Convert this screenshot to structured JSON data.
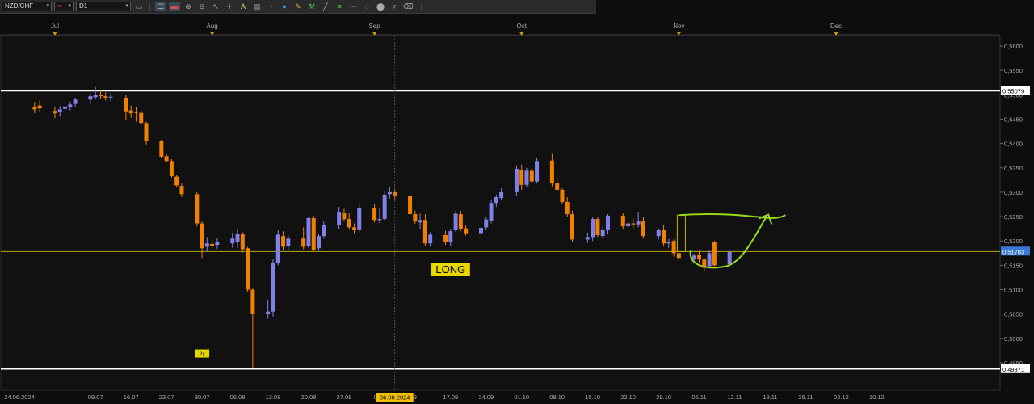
{
  "toolbar": {
    "symbol": "NZD/CHF",
    "link_icon": "link-icon",
    "timeframe": "D1",
    "buttons": [
      "chart-type-icon",
      "bars-icon",
      "candles-icon",
      "zoom-in-icon",
      "zoom-out-icon",
      "cursor-icon",
      "crosshair-icon",
      "text-icon",
      "comment-icon",
      "fill-icon",
      "circle-icon",
      "pencil-icon",
      "tools-icon",
      "line-icon",
      "channel-icon",
      "fib-icon",
      "ellipse-icon",
      "shape-icon",
      "eraser-icon",
      "more-icon"
    ]
  },
  "colors": {
    "bull": "#8080e8",
    "bear": "#f08000",
    "hline_white": "#ffffff",
    "hline_yellow": "#b5a800",
    "current_price_bg": "#3a78d8",
    "annotation": "#9ad91a",
    "long_label_bg": "#e8d800",
    "date_highlight_bg": "#f0c000",
    "rect_outline": "#c8b000"
  },
  "chart_data": {
    "type": "candlestick",
    "symbol": "NZD/CHF",
    "timeframe": "D1",
    "month_labels": [
      "Jul",
      "Aug",
      "Sep",
      "Oct",
      "Nov",
      "Dec"
    ],
    "month_dates": [
      "2024-07-01",
      "2024-08-01",
      "2024-09-02",
      "2024-10-01",
      "2024-11-01",
      "2024-12-02"
    ],
    "x_ticks": [
      "24.06.2024",
      "09.07",
      "16.07",
      "23.07",
      "30.07",
      "06.08",
      "13.08",
      "20.08",
      "27.08",
      "03.0",
      "06.09.2024",
      "9",
      "17.09",
      "24.09",
      "01.10",
      "08.10",
      "15.10",
      "22.10",
      "29.10",
      "05.11",
      "12.11",
      "19.11",
      "26.11",
      "03.12",
      "10.12"
    ],
    "x_tick_dates": [
      "2024-06-24",
      "2024-07-09",
      "2024-07-16",
      "2024-07-23",
      "2024-07-30",
      "2024-08-06",
      "2024-08-13",
      "2024-08-20",
      "2024-08-27",
      "2024-09-03",
      "2024-09-06",
      "2024-09-10",
      "2024-09-17",
      "2024-09-24",
      "2024-10-01",
      "2024-10-08",
      "2024-10-15",
      "2024-10-22",
      "2024-10-29",
      "2024-11-05",
      "2024-11-12",
      "2024-11-19",
      "2024-11-26",
      "2024-12-03",
      "2024-12-10"
    ],
    "highlighted_date": "06.09.2024",
    "y_ticks": [
      "0,5600",
      "0,5550",
      "0,5500",
      "0,5450",
      "0,5400",
      "0,5350",
      "0,5300",
      "0,5250",
      "0,5200",
      "0,5150",
      "0,5100",
      "0,5050",
      "0,5000",
      "0,4950"
    ],
    "y_tick_values": [
      0.56,
      0.555,
      0.55,
      0.545,
      0.54,
      0.535,
      0.53,
      0.525,
      0.52,
      0.515,
      0.51,
      0.505,
      0.5,
      0.495
    ],
    "ylim": [
      0.4925,
      0.5623
    ],
    "levels": [
      {
        "label": "0,55079",
        "value": 0.55079,
        "style": "white"
      },
      {
        "label": "0,51783",
        "value": 0.51783,
        "style": "current"
      },
      {
        "label": "0,49371",
        "value": 0.49371,
        "style": "white"
      }
    ],
    "candles": [
      {
        "d": "2024-06-27",
        "o": 0.5475,
        "h": 0.5485,
        "l": 0.5462,
        "c": 0.547
      },
      {
        "d": "2024-06-28",
        "o": 0.5478,
        "h": 0.5488,
        "l": 0.5465,
        "c": 0.5472
      },
      {
        "d": "2024-07-01",
        "o": 0.5467,
        "h": 0.5476,
        "l": 0.5452,
        "c": 0.5462
      },
      {
        "d": "2024-07-02",
        "o": 0.5464,
        "h": 0.5477,
        "l": 0.5455,
        "c": 0.547
      },
      {
        "d": "2024-07-03",
        "o": 0.5471,
        "h": 0.5483,
        "l": 0.5462,
        "c": 0.5476
      },
      {
        "d": "2024-07-04",
        "o": 0.5475,
        "h": 0.5486,
        "l": 0.5468,
        "c": 0.548
      },
      {
        "d": "2024-07-05",
        "o": 0.5481,
        "h": 0.5494,
        "l": 0.5474,
        "c": 0.549
      },
      {
        "d": "2024-07-08",
        "o": 0.549,
        "h": 0.5502,
        "l": 0.5481,
        "c": 0.5497
      },
      {
        "d": "2024-07-09",
        "o": 0.5495,
        "h": 0.5516,
        "l": 0.549,
        "c": 0.55
      },
      {
        "d": "2024-07-10",
        "o": 0.55,
        "h": 0.551,
        "l": 0.5491,
        "c": 0.5497
      },
      {
        "d": "2024-07-11",
        "o": 0.5497,
        "h": 0.5505,
        "l": 0.5488,
        "c": 0.5494
      },
      {
        "d": "2024-07-12",
        "o": 0.5494,
        "h": 0.5503,
        "l": 0.5486,
        "c": 0.5496
      },
      {
        "d": "2024-07-15",
        "o": 0.5494,
        "h": 0.55,
        "l": 0.5448,
        "c": 0.5466
      },
      {
        "d": "2024-07-16",
        "o": 0.5468,
        "h": 0.5478,
        "l": 0.5453,
        "c": 0.5462
      },
      {
        "d": "2024-07-17",
        "o": 0.5465,
        "h": 0.5474,
        "l": 0.5445,
        "c": 0.5463
      },
      {
        "d": "2024-07-18",
        "o": 0.5463,
        "h": 0.5468,
        "l": 0.5438,
        "c": 0.5442
      },
      {
        "d": "2024-07-19",
        "o": 0.5442,
        "h": 0.5445,
        "l": 0.5398,
        "c": 0.5405
      },
      {
        "d": "2024-07-22",
        "o": 0.5405,
        "h": 0.5408,
        "l": 0.537,
        "c": 0.5373
      },
      {
        "d": "2024-07-23",
        "o": 0.5374,
        "h": 0.5378,
        "l": 0.5362,
        "c": 0.5364
      },
      {
        "d": "2024-07-24",
        "o": 0.5364,
        "h": 0.5368,
        "l": 0.533,
        "c": 0.5333
      },
      {
        "d": "2024-07-25",
        "o": 0.5332,
        "h": 0.5335,
        "l": 0.531,
        "c": 0.5314
      },
      {
        "d": "2024-07-26",
        "o": 0.5313,
        "h": 0.5318,
        "l": 0.529,
        "c": 0.5296
      },
      {
        "d": "2024-07-29",
        "o": 0.5296,
        "h": 0.53,
        "l": 0.523,
        "c": 0.5236
      },
      {
        "d": "2024-07-30",
        "o": 0.5236,
        "h": 0.524,
        "l": 0.5165,
        "c": 0.5185
      },
      {
        "d": "2024-07-31",
        "o": 0.5188,
        "h": 0.5208,
        "l": 0.5178,
        "c": 0.5195
      },
      {
        "d": "2024-08-01",
        "o": 0.5194,
        "h": 0.5207,
        "l": 0.518,
        "c": 0.519
      },
      {
        "d": "2024-08-02",
        "o": 0.5192,
        "h": 0.5206,
        "l": 0.5184,
        "c": 0.5198
      },
      {
        "d": "2024-08-05",
        "o": 0.5195,
        "h": 0.5217,
        "l": 0.5186,
        "c": 0.5205
      },
      {
        "d": "2024-08-06",
        "o": 0.5198,
        "h": 0.5225,
        "l": 0.5185,
        "c": 0.5215
      },
      {
        "d": "2024-08-07",
        "o": 0.5215,
        "h": 0.5218,
        "l": 0.5176,
        "c": 0.5183
      },
      {
        "d": "2024-08-08",
        "o": 0.5185,
        "h": 0.5188,
        "l": 0.5095,
        "c": 0.51
      },
      {
        "d": "2024-08-09",
        "o": 0.51,
        "h": 0.5102,
        "l": 0.494,
        "c": 0.505
      },
      {
        "d": "2024-08-12",
        "o": 0.505,
        "h": 0.508,
        "l": 0.504,
        "c": 0.5055
      },
      {
        "d": "2024-08-13",
        "o": 0.5055,
        "h": 0.5162,
        "l": 0.5045,
        "c": 0.5155
      },
      {
        "d": "2024-08-14",
        "o": 0.5155,
        "h": 0.5222,
        "l": 0.515,
        "c": 0.5213
      },
      {
        "d": "2024-08-15",
        "o": 0.521,
        "h": 0.522,
        "l": 0.518,
        "c": 0.5188
      },
      {
        "d": "2024-08-16",
        "o": 0.519,
        "h": 0.5212,
        "l": 0.5182,
        "c": 0.5205
      },
      {
        "d": "2024-08-19",
        "o": 0.5205,
        "h": 0.5228,
        "l": 0.5183,
        "c": 0.5188
      },
      {
        "d": "2024-08-20",
        "o": 0.519,
        "h": 0.525,
        "l": 0.5185,
        "c": 0.5247
      },
      {
        "d": "2024-08-21",
        "o": 0.5247,
        "h": 0.5252,
        "l": 0.5178,
        "c": 0.5182
      },
      {
        "d": "2024-08-22",
        "o": 0.5185,
        "h": 0.5215,
        "l": 0.518,
        "c": 0.521
      },
      {
        "d": "2024-08-23",
        "o": 0.521,
        "h": 0.524,
        "l": 0.5205,
        "c": 0.5232
      },
      {
        "d": "2024-08-26",
        "o": 0.5232,
        "h": 0.527,
        "l": 0.5225,
        "c": 0.526
      },
      {
        "d": "2024-08-27",
        "o": 0.5258,
        "h": 0.5266,
        "l": 0.524,
        "c": 0.5245
      },
      {
        "d": "2024-08-28",
        "o": 0.5245,
        "h": 0.5258,
        "l": 0.5223,
        "c": 0.5228
      },
      {
        "d": "2024-08-29",
        "o": 0.5228,
        "h": 0.5236,
        "l": 0.5216,
        "c": 0.5222
      },
      {
        "d": "2024-08-30",
        "o": 0.5222,
        "h": 0.5276,
        "l": 0.5218,
        "c": 0.5268
      },
      {
        "d": "2024-09-02",
        "o": 0.5268,
        "h": 0.5275,
        "l": 0.5238,
        "c": 0.5243
      },
      {
        "d": "2024-09-03",
        "o": 0.5243,
        "h": 0.5268,
        "l": 0.5237,
        "c": 0.5245
      },
      {
        "d": "2024-09-04",
        "o": 0.5245,
        "h": 0.5302,
        "l": 0.524,
        "c": 0.5295
      },
      {
        "d": "2024-09-05",
        "o": 0.5296,
        "h": 0.531,
        "l": 0.5287,
        "c": 0.53
      },
      {
        "d": "2024-09-06",
        "o": 0.53,
        "h": 0.5306,
        "l": 0.5284,
        "c": 0.5292
      },
      {
        "d": "2024-09-09",
        "o": 0.5292,
        "h": 0.5298,
        "l": 0.525,
        "c": 0.5255
      },
      {
        "d": "2024-09-10",
        "o": 0.5255,
        "h": 0.5262,
        "l": 0.5235,
        "c": 0.524
      },
      {
        "d": "2024-09-11",
        "o": 0.5238,
        "h": 0.5256,
        "l": 0.5225,
        "c": 0.5243
      },
      {
        "d": "2024-09-12",
        "o": 0.5243,
        "h": 0.5255,
        "l": 0.519,
        "c": 0.5195
      },
      {
        "d": "2024-09-13",
        "o": 0.5195,
        "h": 0.5218,
        "l": 0.5188,
        "c": 0.5213
      },
      {
        "d": "2024-09-16",
        "o": 0.5212,
        "h": 0.5221,
        "l": 0.5192,
        "c": 0.5197
      },
      {
        "d": "2024-09-17",
        "o": 0.5197,
        "h": 0.5225,
        "l": 0.519,
        "c": 0.522
      },
      {
        "d": "2024-09-18",
        "o": 0.5222,
        "h": 0.5262,
        "l": 0.5218,
        "c": 0.5256
      },
      {
        "d": "2024-09-19",
        "o": 0.5255,
        "h": 0.5262,
        "l": 0.522,
        "c": 0.5225
      },
      {
        "d": "2024-09-20",
        "o": 0.5226,
        "h": 0.5233,
        "l": 0.5211,
        "c": 0.5216
      },
      {
        "d": "2024-09-23",
        "o": 0.5216,
        "h": 0.5235,
        "l": 0.5208,
        "c": 0.5227
      },
      {
        "d": "2024-09-24",
        "o": 0.5228,
        "h": 0.525,
        "l": 0.5222,
        "c": 0.5244
      },
      {
        "d": "2024-09-25",
        "o": 0.5242,
        "h": 0.5285,
        "l": 0.5236,
        "c": 0.5278
      },
      {
        "d": "2024-09-26",
        "o": 0.5278,
        "h": 0.5295,
        "l": 0.527,
        "c": 0.529
      },
      {
        "d": "2024-09-27",
        "o": 0.5288,
        "h": 0.5308,
        "l": 0.5283,
        "c": 0.53
      },
      {
        "d": "2024-09-30",
        "o": 0.53,
        "h": 0.5355,
        "l": 0.5292,
        "c": 0.5348
      },
      {
        "d": "2024-10-01",
        "o": 0.5345,
        "h": 0.5357,
        "l": 0.5305,
        "c": 0.5315
      },
      {
        "d": "2024-10-02",
        "o": 0.5315,
        "h": 0.535,
        "l": 0.531,
        "c": 0.5344
      },
      {
        "d": "2024-10-03",
        "o": 0.5344,
        "h": 0.535,
        "l": 0.5318,
        "c": 0.5322
      },
      {
        "d": "2024-10-04",
        "o": 0.5322,
        "h": 0.537,
        "l": 0.5318,
        "c": 0.5364
      },
      {
        "d": "2024-10-07",
        "o": 0.5365,
        "h": 0.538,
        "l": 0.5312,
        "c": 0.5318
      },
      {
        "d": "2024-10-08",
        "o": 0.5318,
        "h": 0.533,
        "l": 0.53,
        "c": 0.5305
      },
      {
        "d": "2024-10-09",
        "o": 0.5305,
        "h": 0.5308,
        "l": 0.5275,
        "c": 0.528
      },
      {
        "d": "2024-10-10",
        "o": 0.528,
        "h": 0.529,
        "l": 0.525,
        "c": 0.5255
      },
      {
        "d": "2024-10-11",
        "o": 0.5255,
        "h": 0.5262,
        "l": 0.5198,
        "c": 0.5203
      },
      {
        "d": "2024-10-14",
        "o": 0.5203,
        "h": 0.5217,
        "l": 0.5196,
        "c": 0.5208
      },
      {
        "d": "2024-10-15",
        "o": 0.5208,
        "h": 0.525,
        "l": 0.52,
        "c": 0.5245
      },
      {
        "d": "2024-10-16",
        "o": 0.5245,
        "h": 0.525,
        "l": 0.5208,
        "c": 0.5212
      },
      {
        "d": "2024-10-17",
        "o": 0.521,
        "h": 0.523,
        "l": 0.5205,
        "c": 0.5222
      },
      {
        "d": "2024-10-18",
        "o": 0.5222,
        "h": 0.5255,
        "l": 0.5215,
        "c": 0.5252
      },
      {
        "d": "2024-10-21",
        "o": 0.5252,
        "h": 0.5258,
        "l": 0.5225,
        "c": 0.523
      },
      {
        "d": "2024-10-22",
        "o": 0.523,
        "h": 0.524,
        "l": 0.522,
        "c": 0.5236
      },
      {
        "d": "2024-10-23",
        "o": 0.5236,
        "h": 0.5246,
        "l": 0.5226,
        "c": 0.5234
      },
      {
        "d": "2024-10-24",
        "o": 0.5234,
        "h": 0.526,
        "l": 0.5228,
        "c": 0.524
      },
      {
        "d": "2024-10-25",
        "o": 0.524,
        "h": 0.525,
        "l": 0.5205,
        "c": 0.521
      },
      {
        "d": "2024-10-28",
        "o": 0.521,
        "h": 0.5226,
        "l": 0.5203,
        "c": 0.5222
      },
      {
        "d": "2024-10-29",
        "o": 0.5222,
        "h": 0.5232,
        "l": 0.519,
        "c": 0.5195
      },
      {
        "d": "2024-10-30",
        "o": 0.5195,
        "h": 0.5204,
        "l": 0.5186,
        "c": 0.5198
      },
      {
        "d": "2024-10-31",
        "o": 0.52,
        "h": 0.5203,
        "l": 0.5168,
        "c": 0.5175
      },
      {
        "d": "2024-11-01",
        "o": 0.5175,
        "h": 0.5182,
        "l": 0.5158,
        "c": 0.5165
      },
      {
        "d": "2024-11-04",
        "o": 0.5162,
        "h": 0.5174,
        "l": 0.5155,
        "c": 0.517
      },
      {
        "d": "2024-11-05",
        "o": 0.5172,
        "h": 0.518,
        "l": 0.5155,
        "c": 0.5162
      },
      {
        "d": "2024-11-06",
        "o": 0.5162,
        "h": 0.5165,
        "l": 0.5138,
        "c": 0.5145
      },
      {
        "d": "2024-11-07",
        "o": 0.5148,
        "h": 0.5182,
        "l": 0.5145,
        "c": 0.5175
      },
      {
        "d": "2024-11-08",
        "o": 0.5198,
        "h": 0.52,
        "l": 0.5148,
        "c": 0.515
      },
      {
        "d": "2024-11-11",
        "o": 0.5152,
        "h": 0.518,
        "l": 0.5148,
        "c": 0.5178
      }
    ],
    "annotations": [
      {
        "type": "label",
        "text": "LONG",
        "date": "2024-09-17",
        "value": 0.5142
      },
      {
        "type": "label",
        "text": "2x",
        "date": "2024-07-30",
        "value": 0.4969
      },
      {
        "type": "vline",
        "date": "2024-09-06"
      },
      {
        "type": "vline",
        "date": "2024-09-09"
      }
    ]
  }
}
